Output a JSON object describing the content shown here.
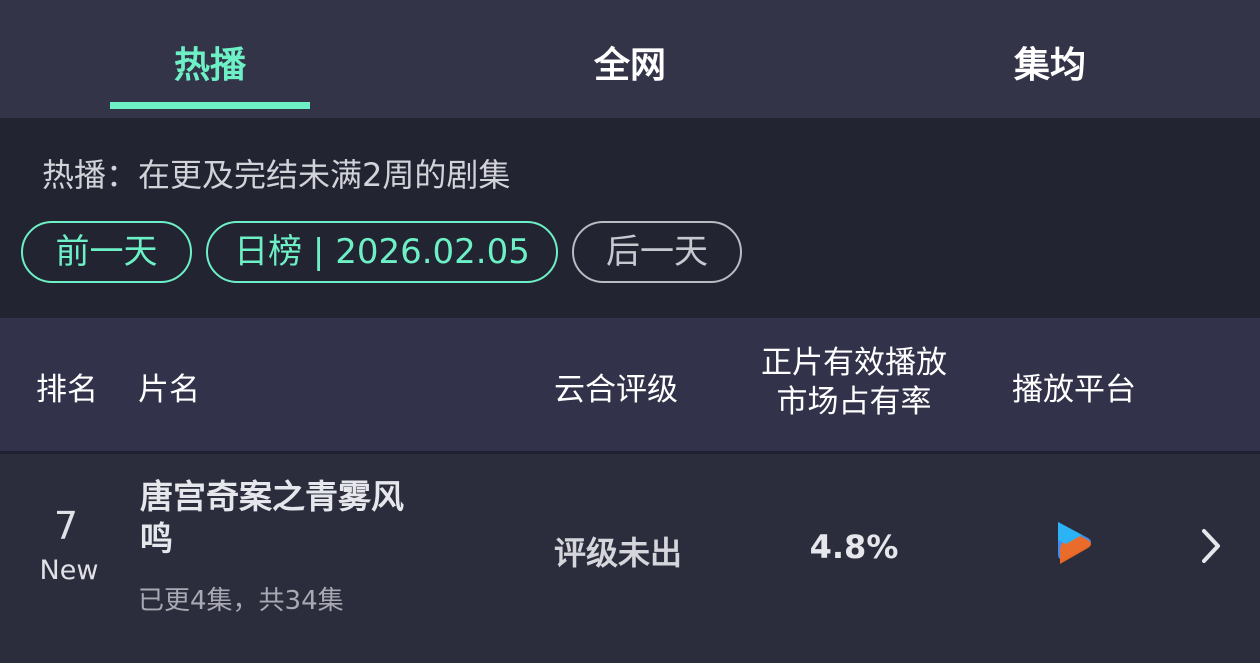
{
  "tabs": [
    {
      "label": "热播",
      "active": true
    },
    {
      "label": "全网",
      "active": false
    },
    {
      "label": "集均",
      "active": false
    }
  ],
  "info": {
    "description": "热播：在更及完结未满2周的剧集",
    "prev_day": "前一天",
    "current": "日榜 | 2026.02.05",
    "next_day": "后一天"
  },
  "table": {
    "headers": {
      "rank": "排名",
      "title": "片名",
      "rating": "云合评级",
      "share_line1": "正片有效播放",
      "share_line2": "市场占有率",
      "platform": "播放平台"
    },
    "rows": [
      {
        "rank": "7",
        "badge": "New",
        "title": "唐宫奇案之青雾风鸣",
        "episodes": "已更4集，共34集",
        "rating": "评级未出",
        "share": "4.8%",
        "platform_icon": "play-logo-icon"
      }
    ]
  },
  "colors": {
    "accent": "#6ef0c6",
    "background": "#2b2d3c",
    "tab_bar": "#333447",
    "info_bg": "#222431",
    "header_bg": "#32334a"
  }
}
